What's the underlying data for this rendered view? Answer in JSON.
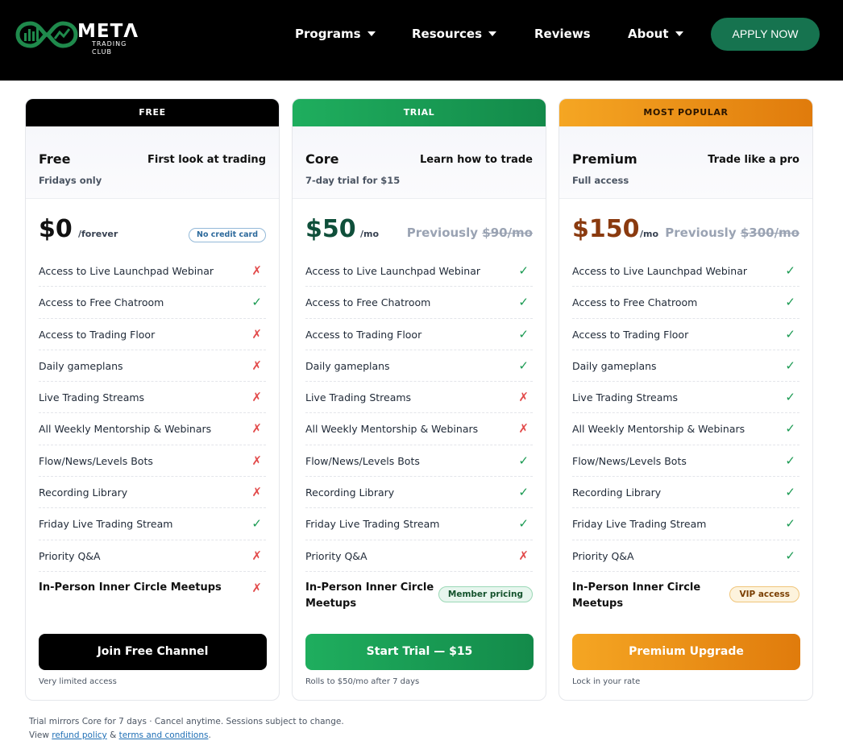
{
  "header": {
    "logo_word": "METΛ",
    "logo_sub": "TRADING CLUB",
    "nav": [
      {
        "label": "Programs",
        "dropdown": true
      },
      {
        "label": "Resources",
        "dropdown": true
      },
      {
        "label": "Reviews",
        "dropdown": false
      },
      {
        "label": "About",
        "dropdown": true
      }
    ],
    "apply_label": "APPLY NOW"
  },
  "plans": [
    {
      "band": "FREE",
      "name": "Free",
      "tagline": "First look at trading",
      "subtitle": "Fridays only",
      "price": "$0",
      "per": "/forever",
      "badge": "No credit card",
      "features": [
        {
          "label": "Access to Live Launchpad Webinar",
          "included": false
        },
        {
          "label": "Access to Free Chatroom",
          "included": true
        },
        {
          "label": "Access to Trading Floor",
          "included": false
        },
        {
          "label": "Daily gameplans",
          "included": false
        },
        {
          "label": "Live Trading Streams",
          "included": false
        },
        {
          "label": "All Weekly Mentorship & Webinars",
          "included": false
        },
        {
          "label": "Flow/News/Levels Bots",
          "included": false
        },
        {
          "label": "Recording Library",
          "included": false
        },
        {
          "label": "Friday Live Trading Stream",
          "included": true
        },
        {
          "label": "Priority Q&A",
          "included": false
        }
      ],
      "meetups": {
        "label": "In-Person Inner Circle Meetups",
        "included": false
      },
      "cta": "Join Free Channel",
      "note": "Very limited access"
    },
    {
      "band": "TRIAL",
      "name": "Core",
      "tagline": "Learn how to trade",
      "subtitle": "7-day trial for $15",
      "price": "$50",
      "per": "/mo",
      "previously_prefix": "Previously ",
      "previously_value": "$90/mo",
      "features": [
        {
          "label": "Access to Live Launchpad Webinar",
          "included": true
        },
        {
          "label": "Access to Free Chatroom",
          "included": true
        },
        {
          "label": "Access to Trading Floor",
          "included": true
        },
        {
          "label": "Daily gameplans",
          "included": true
        },
        {
          "label": "Live Trading Streams",
          "included": false
        },
        {
          "label": "All Weekly Mentorship & Webinars",
          "included": false
        },
        {
          "label": "Flow/News/Levels Bots",
          "included": true
        },
        {
          "label": "Recording Library",
          "included": true
        },
        {
          "label": "Friday Live Trading Stream",
          "included": true
        },
        {
          "label": "Priority Q&A",
          "included": false
        }
      ],
      "meetups": {
        "label": "In-Person Inner Circle Meetups",
        "pill": "Member pricing"
      },
      "cta": "Start Trial — $15",
      "note": "Rolls to $50/mo after 7 days"
    },
    {
      "band": "MOST POPULAR",
      "name": "Premium",
      "tagline": "Trade like a pro",
      "subtitle": "Full access",
      "price": "$150",
      "per": "/mo",
      "previously_prefix": "Previously ",
      "previously_value": "$300/mo",
      "features": [
        {
          "label": "Access to Live Launchpad Webinar",
          "included": true
        },
        {
          "label": "Access to Free Chatroom",
          "included": true
        },
        {
          "label": "Access to Trading Floor",
          "included": true
        },
        {
          "label": "Daily gameplans",
          "included": true
        },
        {
          "label": "Live Trading Streams",
          "included": true
        },
        {
          "label": "All Weekly Mentorship & Webinars",
          "included": true
        },
        {
          "label": "Flow/News/Levels Bots",
          "included": true
        },
        {
          "label": "Recording Library",
          "included": true
        },
        {
          "label": "Friday Live Trading Stream",
          "included": true
        },
        {
          "label": "Priority Q&A",
          "included": true
        }
      ],
      "meetups": {
        "label": "In-Person Inner Circle Meetups",
        "pill": "VIP access"
      },
      "cta": "Premium Upgrade",
      "note": "Lock in your rate"
    }
  ],
  "icons": {
    "yes": "✓",
    "no": "✗"
  },
  "colors": {
    "accent_green": "#16734f",
    "core_price": "#0f4f3a",
    "premium_price": "#8a3a0f",
    "check_green": "#1a9a52",
    "cross_red": "#e24a4a"
  },
  "footer": {
    "line1": "Trial mirrors Core for 7 days · Cancel anytime. Sessions subject to change.",
    "view": "View ",
    "refund_link": "refund policy",
    "amp": " & ",
    "terms_link": "terms and conditions",
    "period": "."
  }
}
